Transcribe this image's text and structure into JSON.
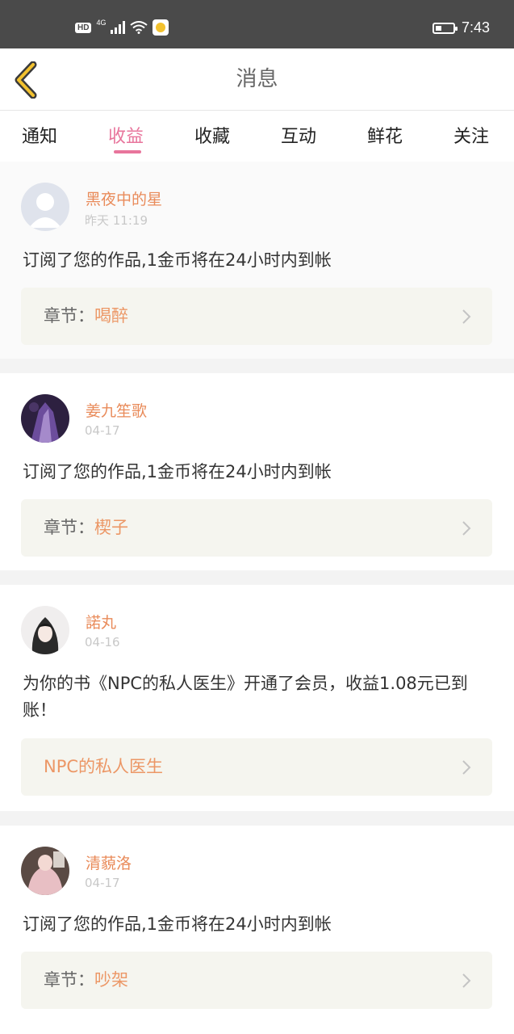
{
  "status_bar": {
    "hd": "HD",
    "network": "4G",
    "time": "7:43"
  },
  "header": {
    "title": "消息",
    "back_icon": "chevron-left-icon"
  },
  "tabs": [
    {
      "label": "通知",
      "active": false
    },
    {
      "label": "收益",
      "active": true
    },
    {
      "label": "收藏",
      "active": false
    },
    {
      "label": "互动",
      "active": false
    },
    {
      "label": "鲜花",
      "active": false
    },
    {
      "label": "关注",
      "active": false
    }
  ],
  "colors": {
    "accent_pink": "#e8759c",
    "name_orange": "#e98b5a",
    "chapter_orange": "#ec9766"
  },
  "messages": [
    {
      "username": "黑夜中的星",
      "time": "昨天 11:19",
      "text": "订阅了您的作品,1金币将在24小时内到帐",
      "chapter_label": "章节：",
      "chapter_value": "喝醉"
    },
    {
      "username": "姜九笙歌",
      "time": "04-17",
      "text": "订阅了您的作品,1金币将在24小时内到帐",
      "chapter_label": "章节：",
      "chapter_value": "楔子"
    },
    {
      "username": "諾丸",
      "time": "04-16",
      "text": "为你的书《NPC的私人医生》开通了会员，收益1.08元已到账！",
      "chapter_label": "",
      "chapter_value": "NPC的私人医生"
    },
    {
      "username": "清藐洛",
      "time": "04-17",
      "text": "订阅了您的作品,1金币将在24小时内到帐",
      "chapter_label": "章节：",
      "chapter_value": "吵架"
    }
  ]
}
